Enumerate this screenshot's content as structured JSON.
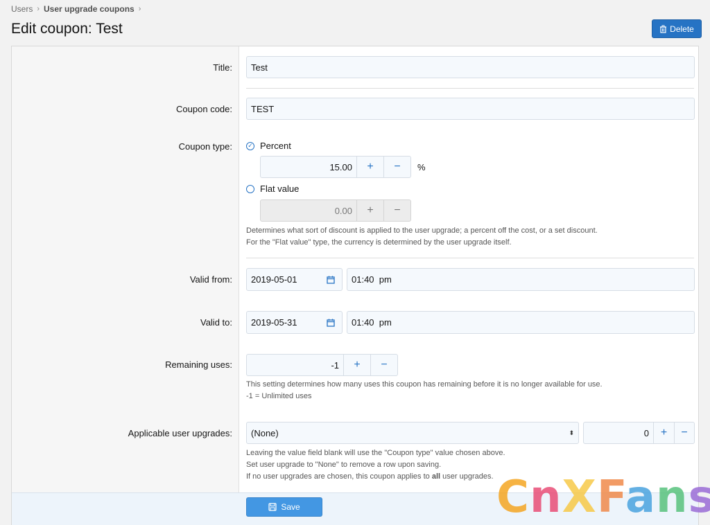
{
  "breadcrumb": {
    "items": [
      "Users",
      "User upgrade coupons"
    ]
  },
  "page": {
    "title": "Edit coupon: Test",
    "delete_label": "Delete"
  },
  "form": {
    "title_label": "Title:",
    "title_value": "Test",
    "code_label": "Coupon code:",
    "code_value": "TEST",
    "type_label": "Coupon type:",
    "percent_label": "Percent",
    "percent_value": "15.00",
    "percent_unit": "%",
    "flat_label": "Flat value",
    "flat_value": "0.00",
    "type_hint": [
      "Determines what sort of discount is applied to the user upgrade; a percent off the cost, or a set discount.",
      "For the \"Flat value\" type, the currency is determined by the user upgrade itself."
    ],
    "valid_from_label": "Valid from:",
    "valid_from_date": "2019-05-01",
    "valid_from_time": "01:40  pm",
    "valid_to_label": "Valid to:",
    "valid_to_date": "2019-05-31",
    "valid_to_time": "01:40  pm",
    "remaining_label": "Remaining uses:",
    "remaining_value": "-1",
    "remaining_hint": [
      "This setting determines how many uses this coupon has remaining before it is no longer available for use.",
      "-1 = Unlimited uses"
    ],
    "upgrades_label": "Applicable user upgrades:",
    "upgrades_selected": "(None)",
    "upgrades_value": "0",
    "upgrades_hint": [
      "Leaving the value field blank will use the \"Coupon type\" value chosen above.",
      "Set user upgrade to \"None\" to remove a row upon saving.",
      "If no user upgrades are chosen, this coupon applies to ",
      "all",
      " user upgrades."
    ],
    "plus_symbol": "+",
    "minus_symbol": "−",
    "select_arrow": "⬍"
  },
  "footer": {
    "save_label": "Save"
  },
  "watermark": {
    "parts": [
      "C",
      "n",
      "X",
      "F",
      "a",
      "n",
      "s"
    ]
  },
  "colors": {
    "accent": "#2673c4",
    "save": "#4397e3",
    "input_bg": "#f5f9fd"
  }
}
